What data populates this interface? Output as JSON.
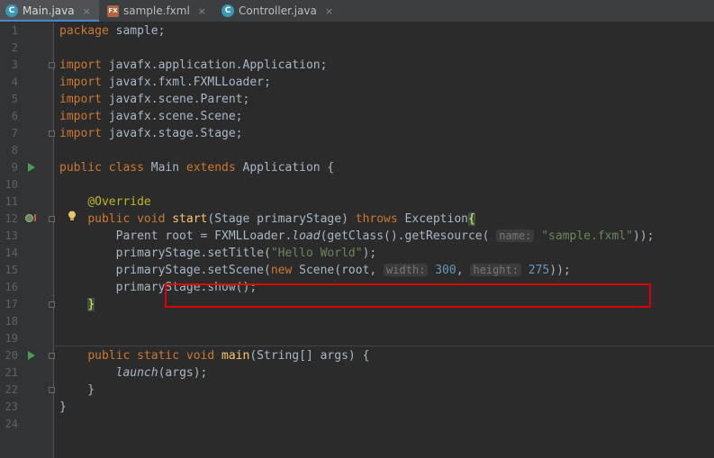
{
  "tabs": [
    {
      "label": "Main.java",
      "icon": "java-class-icon",
      "active": true
    },
    {
      "label": "sample.fxml",
      "icon": "fxml-file-icon",
      "active": false
    },
    {
      "label": "Controller.java",
      "icon": "java-class-icon",
      "active": false
    }
  ],
  "tab_close_glyph": "×",
  "icon_glyphs": {
    "java": "C",
    "fxml": "FX"
  },
  "line_numbers": [
    "1",
    "2",
    "3",
    "4",
    "5",
    "6",
    "7",
    "8",
    "9",
    "10",
    "11",
    "12",
    "13",
    "14",
    "15",
    "16",
    "17",
    "18",
    "19",
    "20",
    "21",
    "22",
    "23",
    "24"
  ],
  "code": {
    "l1": [
      "package",
      " sample;"
    ],
    "l3": [
      "import",
      " javafx.application.Application;"
    ],
    "l4": [
      "import",
      " javafx.fxml.FXMLLoader;"
    ],
    "l5": [
      "import",
      " javafx.scene.Parent;"
    ],
    "l6": [
      "import",
      " javafx.scene.Scene;"
    ],
    "l7": [
      "import",
      " javafx.stage.Stage;"
    ],
    "l9": [
      "public class",
      " Main ",
      "extends",
      " Application {"
    ],
    "l11": [
      "    ",
      "@Override"
    ],
    "l12": [
      "    ",
      "public void",
      " ",
      "start",
      "(Stage primaryStage) ",
      "throws",
      " Exception",
      "{"
    ],
    "l13": [
      "        Parent root = FXMLLoader.",
      "load",
      "(getClass().getResource( ",
      "name:",
      " ",
      "\"sample.fxml\"",
      "));"
    ],
    "l14": [
      "        primaryStage.setTitle(",
      "\"Hello World\"",
      ");"
    ],
    "l15": [
      "        primaryStage.setScene(",
      "new",
      " Scene(root, ",
      "width:",
      " ",
      "300",
      ", ",
      "height:",
      " ",
      "275",
      "));"
    ],
    "l16": [
      "        primaryStage.show();"
    ],
    "l17": [
      "    ",
      "}"
    ],
    "l20": [
      "    ",
      "public static void",
      " ",
      "main",
      "(String[] args) {"
    ],
    "l21": [
      "        ",
      "launch",
      "(args);"
    ],
    "l22": [
      "    }"
    ],
    "l23": [
      "}"
    ]
  },
  "colors": {
    "background": "#2b2b2b",
    "keyword": "#cc7832",
    "annotation": "#bbb529",
    "method": "#ffc66d",
    "string": "#6a8759",
    "number": "#6897bb",
    "highlight_box": "#e10000"
  }
}
